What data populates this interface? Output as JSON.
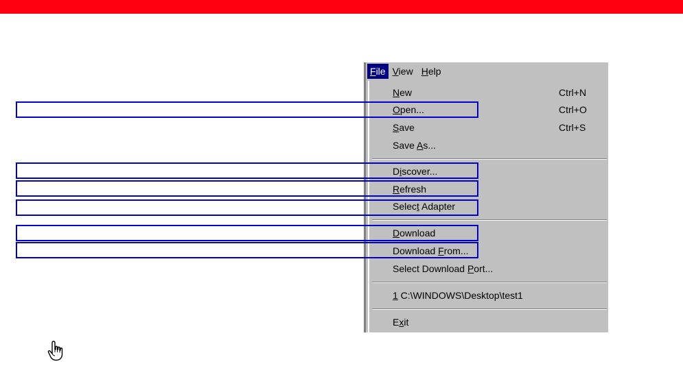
{
  "menubar": {
    "items": [
      {
        "pre": "",
        "ul": "F",
        "post": "ile",
        "active": true
      },
      {
        "pre": "",
        "ul": "V",
        "post": "iew",
        "active": false
      },
      {
        "pre": "",
        "ul": "H",
        "post": "elp",
        "active": false
      }
    ]
  },
  "file_menu": {
    "items": [
      {
        "pre": "",
        "ul": "N",
        "post": "ew",
        "shortcut": "Ctrl+N"
      },
      {
        "pre": "",
        "ul": "O",
        "post": "pen...",
        "shortcut": "Ctrl+O"
      },
      {
        "pre": "",
        "ul": "S",
        "post": "ave",
        "shortcut": "Ctrl+S"
      },
      {
        "pre": "Save ",
        "ul": "A",
        "post": "s...",
        "shortcut": ""
      },
      {
        "pre": "D",
        "ul": "i",
        "post": "scover...",
        "shortcut": ""
      },
      {
        "pre": "",
        "ul": "R",
        "post": "efresh",
        "shortcut": ""
      },
      {
        "pre": "Selec",
        "ul": "t",
        "post": " Adapter",
        "shortcut": ""
      },
      {
        "pre": "",
        "ul": "D",
        "post": "ownload",
        "shortcut": ""
      },
      {
        "pre": "Download ",
        "ul": "F",
        "post": "rom...",
        "shortcut": ""
      },
      {
        "pre": "Select Download ",
        "ul": "P",
        "post": "ort...",
        "shortcut": ""
      },
      {
        "pre": "",
        "ul": "1",
        "post": " C:\\WINDOWS\\Desktop\\test1",
        "shortcut": ""
      },
      {
        "pre": "E",
        "ul": "x",
        "post": "it",
        "shortcut": ""
      }
    ]
  },
  "colors": {
    "top_bar": "#ff0010",
    "callout_border": "#0000c8",
    "menu_bg": "#c0c0c0",
    "menu_highlight": "#000080"
  },
  "icons": {
    "note": "pointing-hand-icon"
  }
}
